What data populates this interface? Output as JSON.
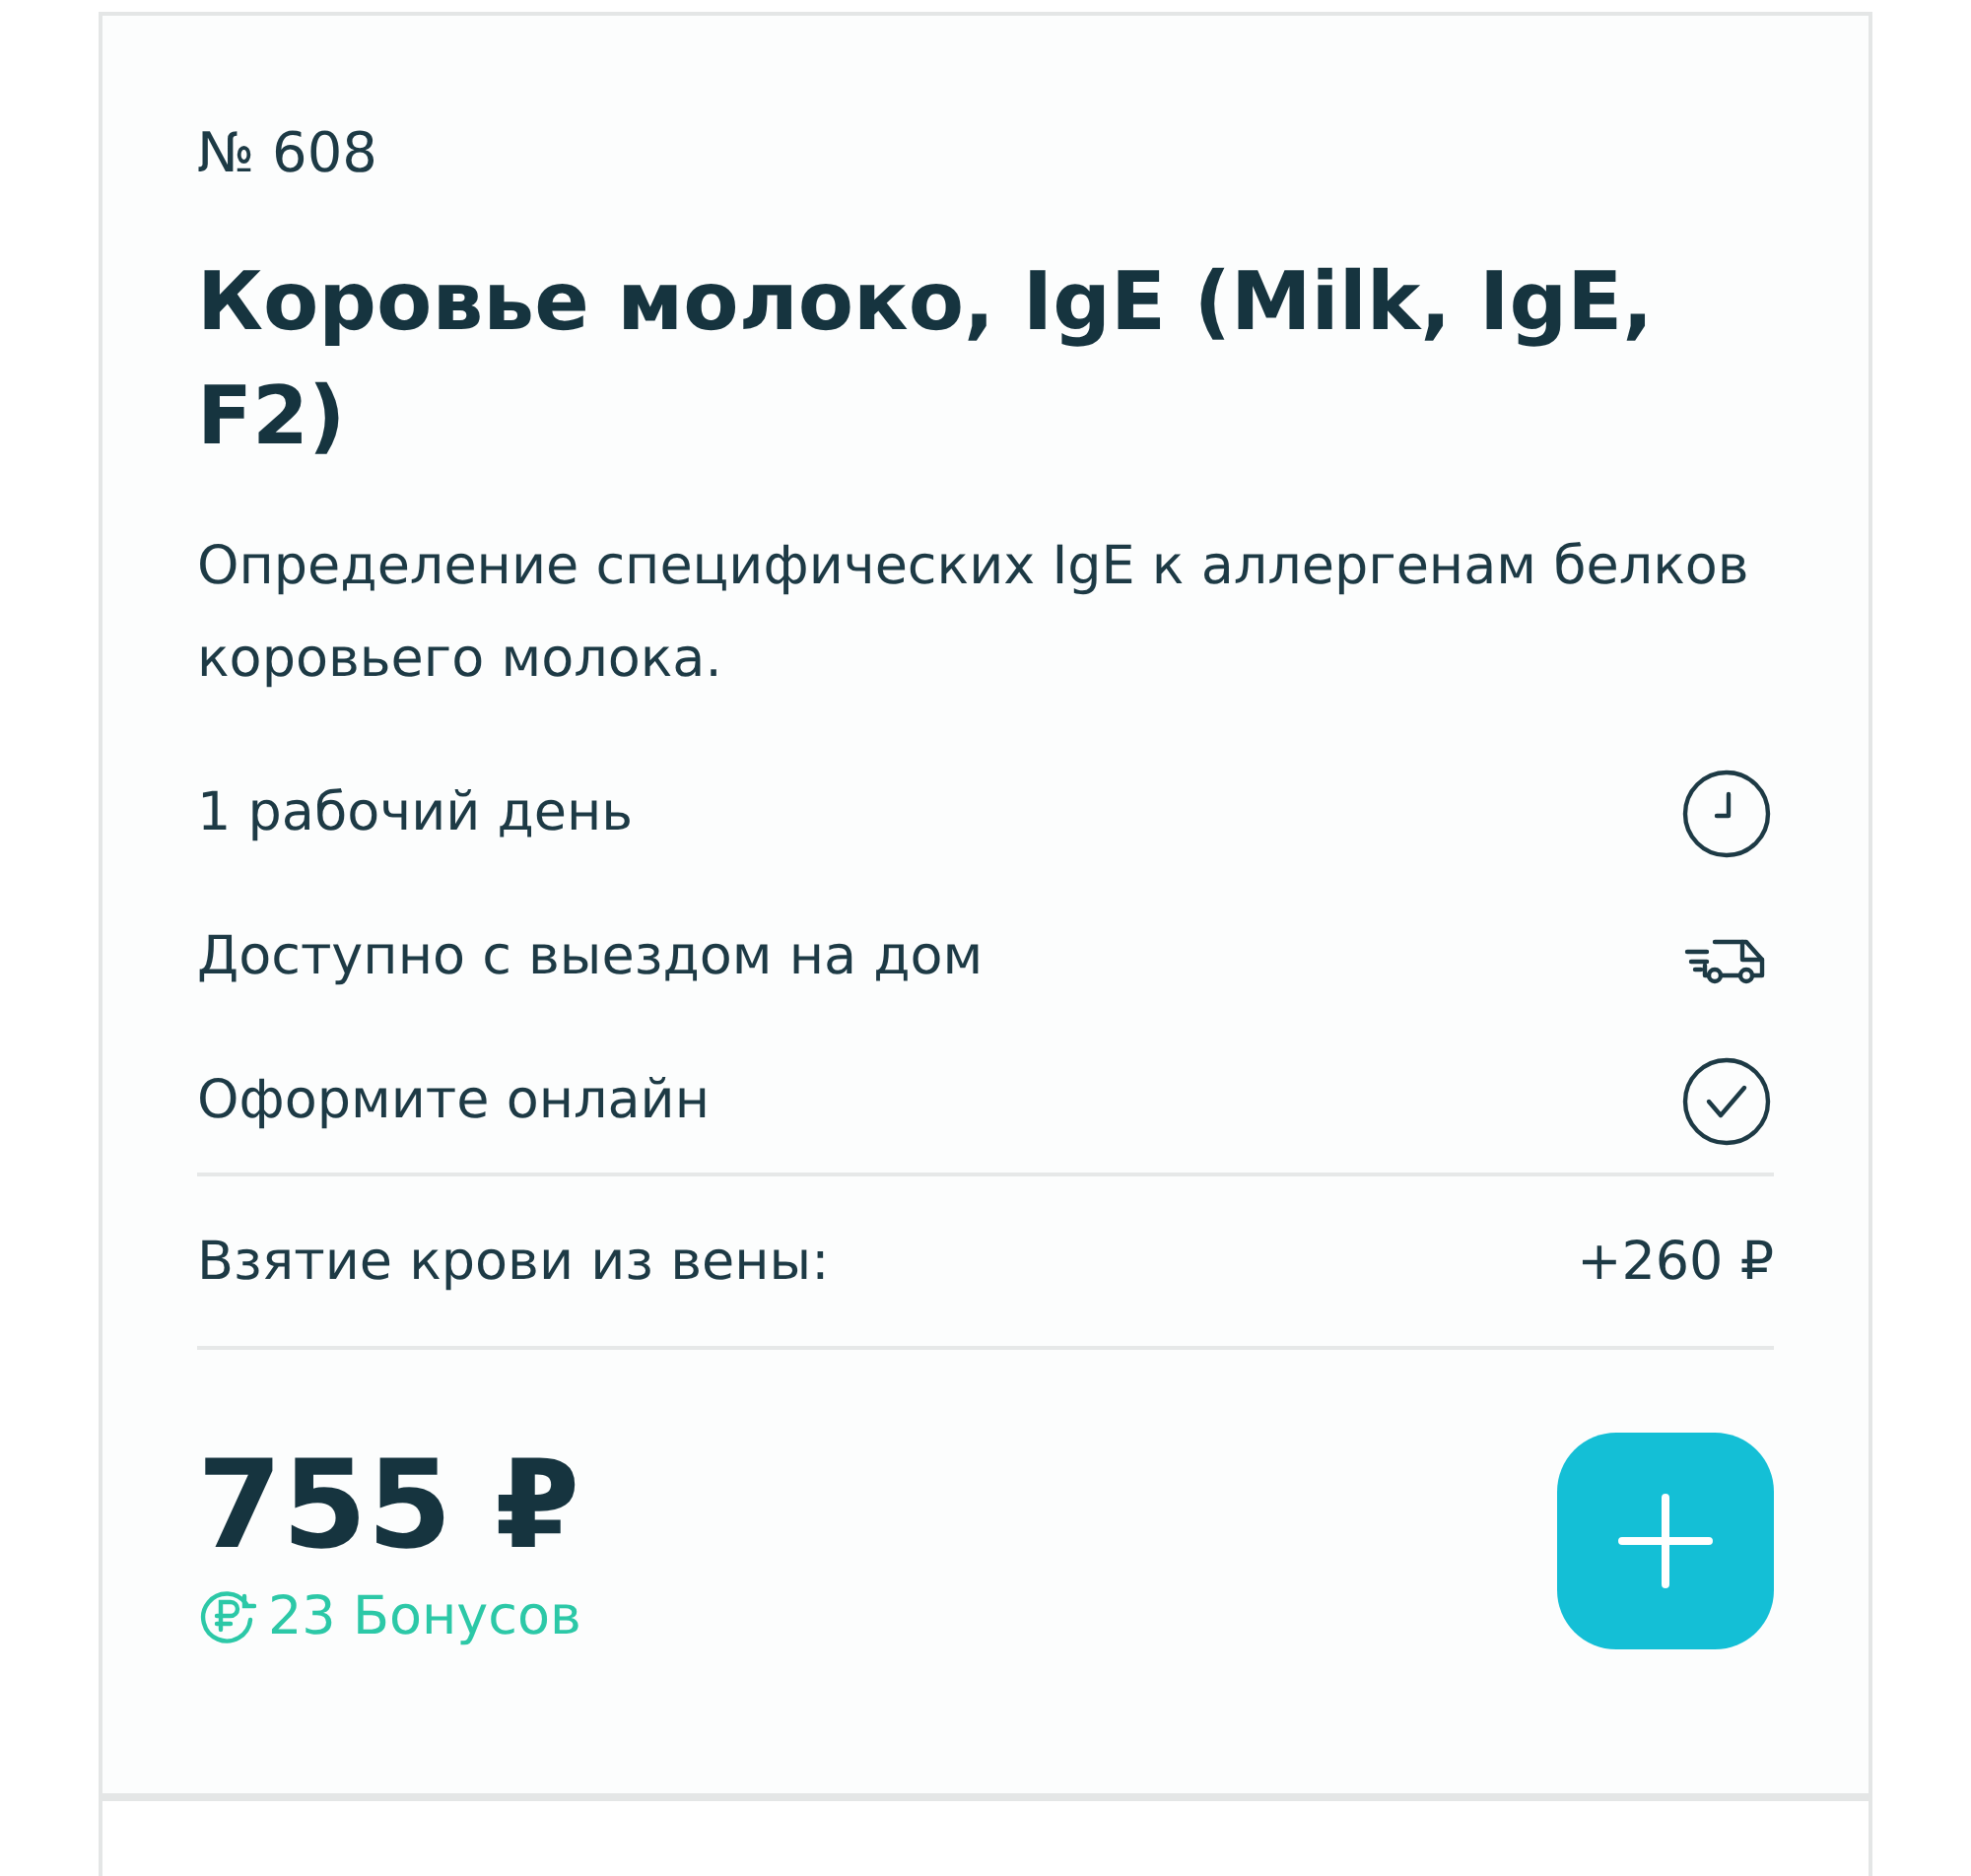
{
  "card": {
    "number": "№ 608",
    "title": "Коровье молоко, IgE (Milk, IgE, F2)",
    "description": "Определение специфических IgE к аллергенам белков коровьего молока.",
    "features": [
      {
        "label": "1 рабочий день",
        "kind": "clock"
      },
      {
        "label": "Доступно с выездом на дом",
        "kind": "van"
      },
      {
        "label": "Оформите онлайн",
        "kind": "check"
      }
    ],
    "extra": {
      "label": "Взятие крови из вены:",
      "price": "+260 ₽"
    },
    "price": "755 ₽",
    "bonus": "23 Бонусов"
  }
}
